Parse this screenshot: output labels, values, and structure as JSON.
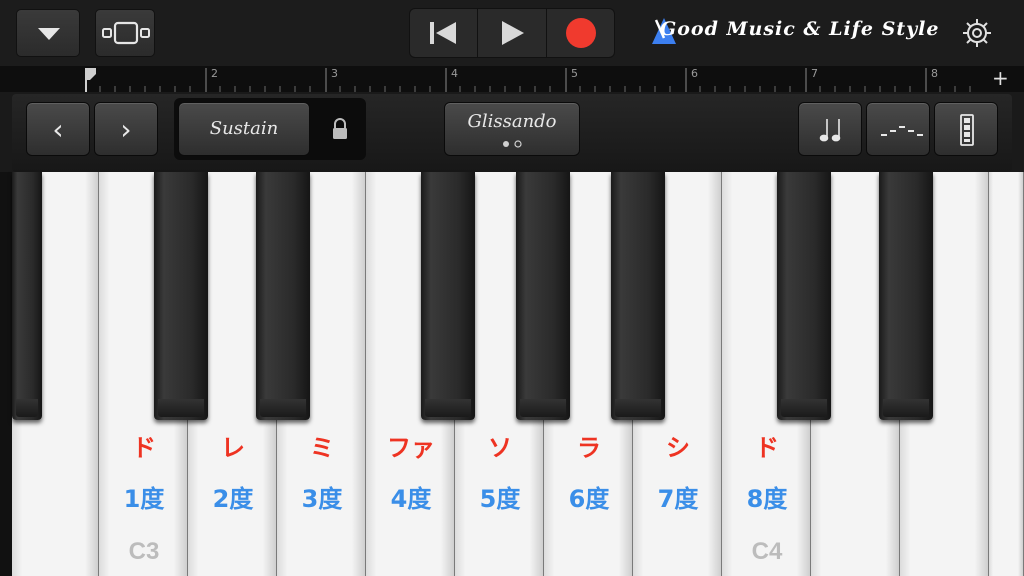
{
  "topbar": {
    "menu_button": "chevron-down-icon",
    "view_button": "keyboard-view-icon",
    "transport": {
      "rewind": "rewind-icon",
      "play": "play-icon",
      "record": "record-icon"
    },
    "brand_text": "Good Music & Life Style",
    "metronome_icon": "metronome-icon",
    "settings_icon": "gear-icon"
  },
  "ruler": {
    "bars": [
      "2",
      "3",
      "4",
      "5",
      "6",
      "7",
      "8"
    ],
    "add_label": "+"
  },
  "controls": {
    "octave_down": "‹",
    "octave_up": "›",
    "sustain_label": "Sustain",
    "lock_icon": "lock-icon",
    "glissando_label": "Glissando",
    "arpeggiator_icon": "note-icon",
    "scale_icon": "scale-icon",
    "velocity_icon": "velocity-icon"
  },
  "keyboard": {
    "solfege": [
      "ド",
      "レ",
      "ミ",
      "ファ",
      "ソ",
      "ラ",
      "シ",
      "ド"
    ],
    "degrees": [
      "1度",
      "2度",
      "3度",
      "4度",
      "5度",
      "6度",
      "7度",
      "8度"
    ],
    "octave_labels": [
      "C3",
      "C4"
    ]
  },
  "colors": {
    "record": "#f03a2e",
    "solfege": "#ee3322",
    "degree": "#3a8ee8",
    "octave_label": "#bcbcbc"
  }
}
